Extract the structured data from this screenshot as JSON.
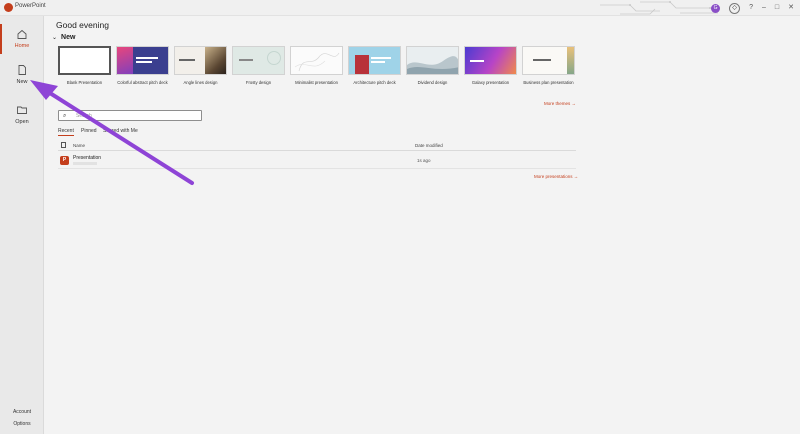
{
  "app": {
    "title": "PowerPoint"
  },
  "titlebar": {
    "avatar_initials": "G",
    "help_label": "?",
    "minimize": "–",
    "maximize": "□",
    "close": "✕"
  },
  "sidebar": {
    "items": [
      {
        "label": "Home",
        "icon": "home-icon"
      },
      {
        "label": "New",
        "icon": "new-document-icon"
      },
      {
        "label": "Open",
        "icon": "folder-open-icon"
      }
    ],
    "bottom": [
      {
        "label": "Account"
      },
      {
        "label": "Options"
      }
    ]
  },
  "main": {
    "greeting": "Good evening",
    "new_section": {
      "title": "New",
      "more_label": "More themes"
    },
    "templates": [
      {
        "name": "Blank Presentation"
      },
      {
        "name": "Colorful abstract pitch deck"
      },
      {
        "name": "Angle lines design"
      },
      {
        "name": "Frosty design"
      },
      {
        "name": "Minimalist presentation"
      },
      {
        "name": "Architecture pitch deck"
      },
      {
        "name": "Dividend design"
      },
      {
        "name": "Galaxy presentation"
      },
      {
        "name": "Business plan presentation"
      }
    ],
    "search": {
      "placeholder": "Search"
    },
    "tabs": [
      {
        "label": "Recent"
      },
      {
        "label": "Pinned"
      },
      {
        "label": "Shared with Me"
      }
    ],
    "list": {
      "col_name": "Name",
      "col_date": "Date modified",
      "rows": [
        {
          "name": "Presentation",
          "date": "1s ago"
        }
      ],
      "more_label": "More presentations"
    }
  },
  "colors": {
    "accent": "#c43e1c",
    "annotation_arrow": "#8e44d6"
  }
}
